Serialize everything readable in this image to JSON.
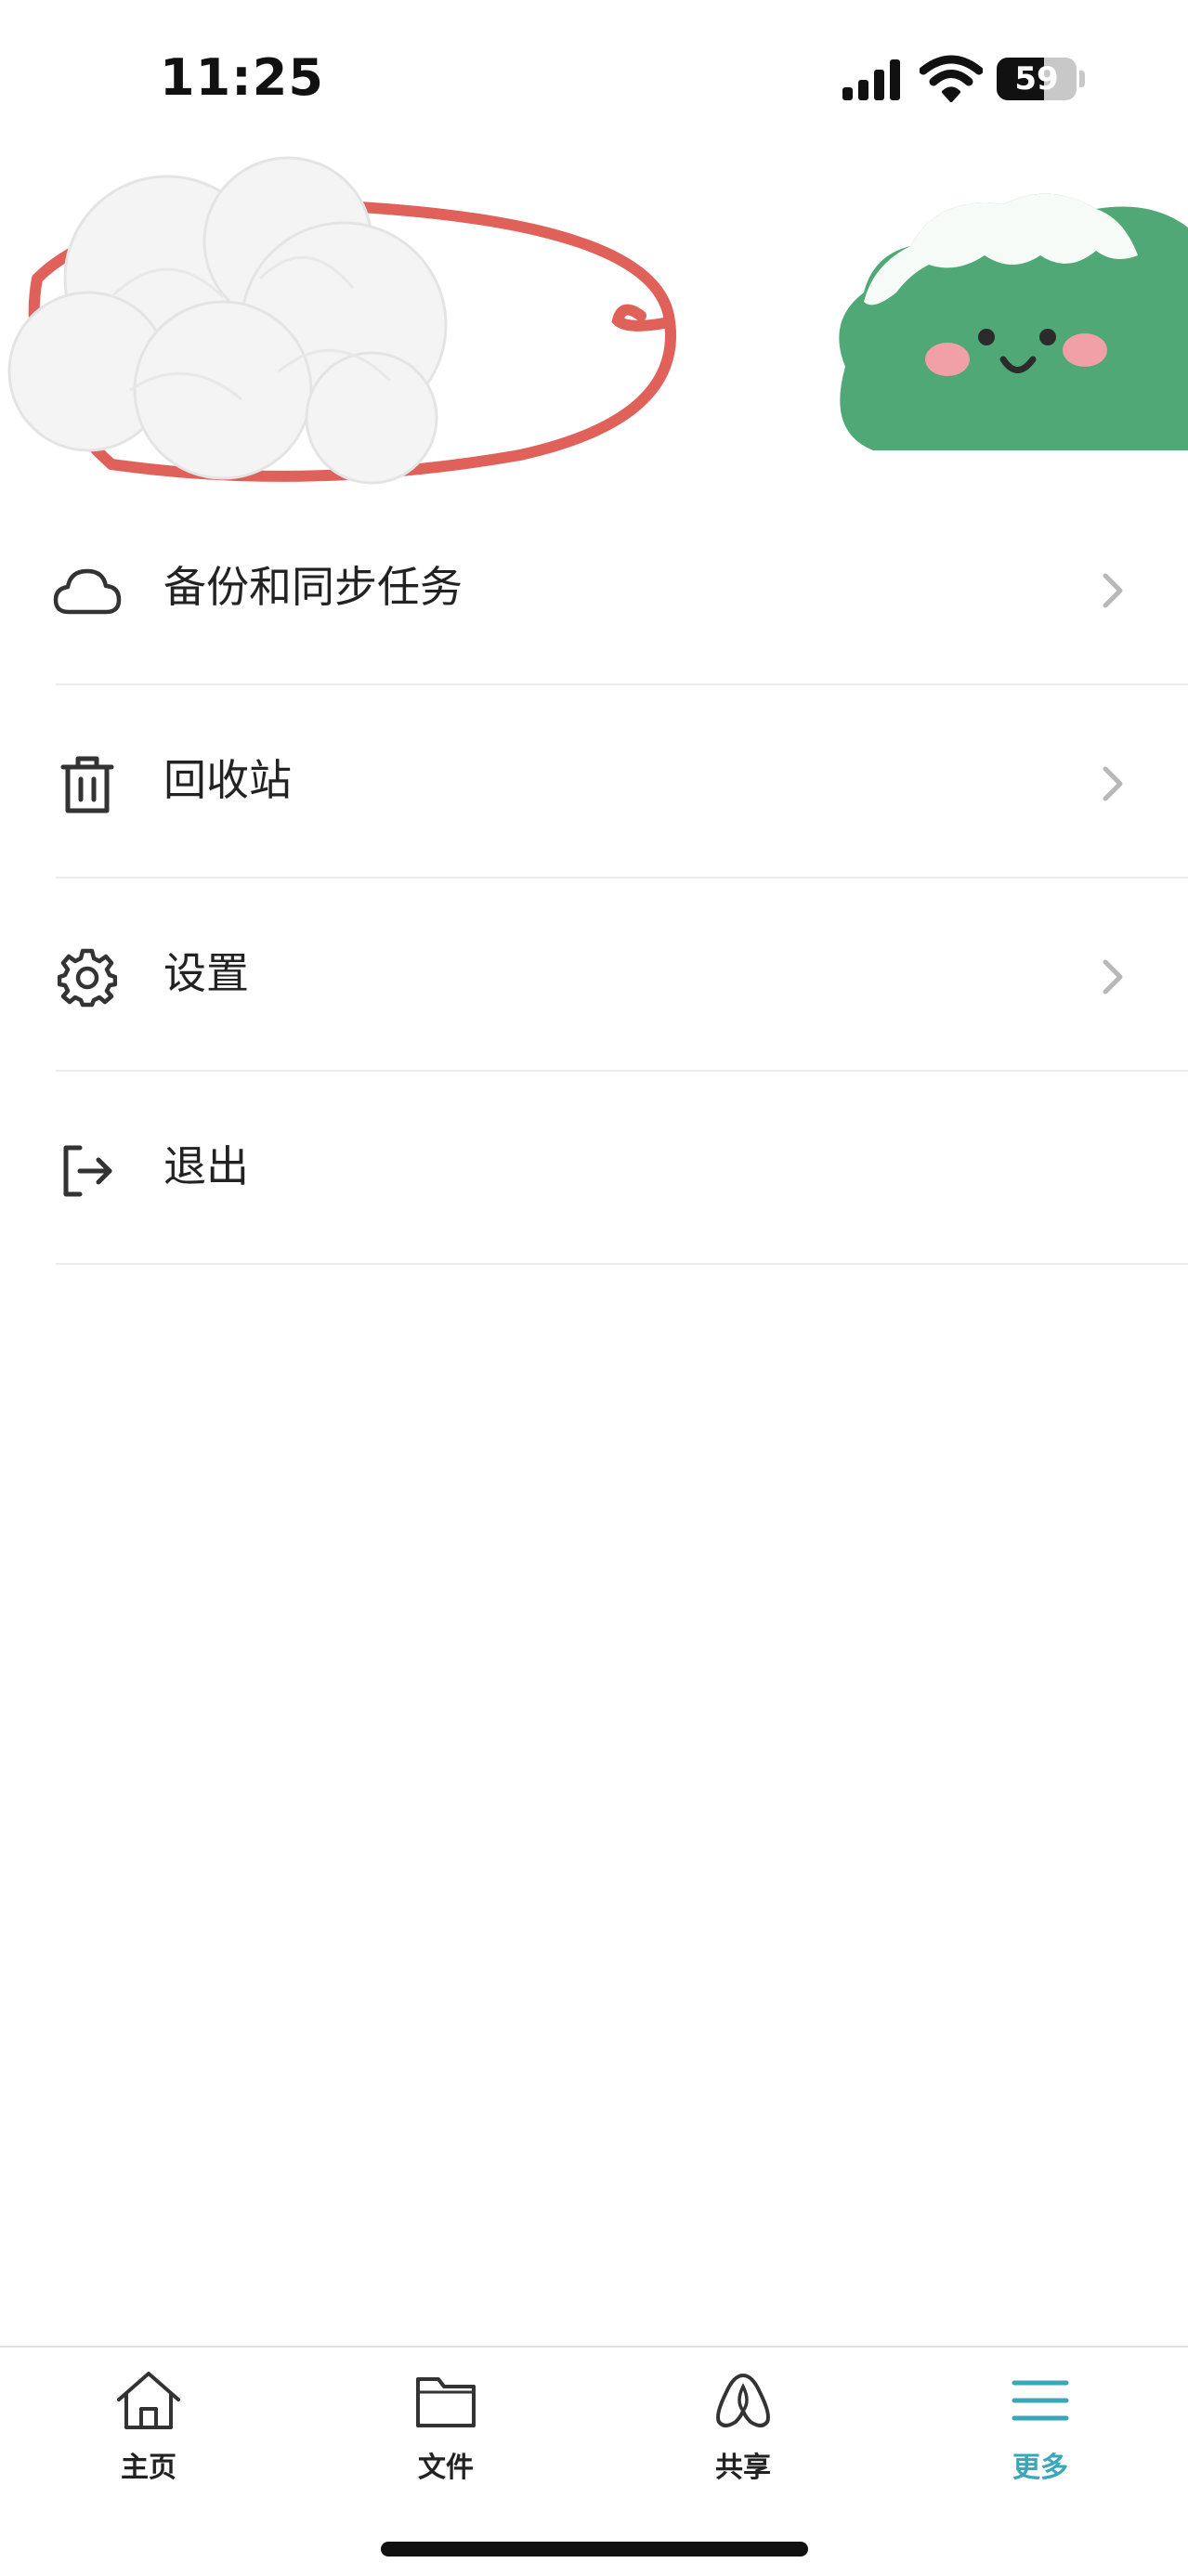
{
  "status_bar": {
    "time": "11:25",
    "battery_level": "59",
    "battery_fraction": 0.59
  },
  "menu": {
    "items": [
      {
        "label": "备份和同步任务",
        "icon": "cloud-icon",
        "has_chevron": true
      },
      {
        "label": "回收站",
        "icon": "trash-icon",
        "has_chevron": true
      },
      {
        "label": "设置",
        "icon": "gear-icon",
        "has_chevron": true
      },
      {
        "label": "退出",
        "icon": "logout-icon",
        "has_chevron": false
      }
    ]
  },
  "tab_bar": {
    "tabs": [
      {
        "label": "主页",
        "icon": "home-icon",
        "active": false
      },
      {
        "label": "文件",
        "icon": "folder-icon",
        "active": false
      },
      {
        "label": "共享",
        "icon": "share-icon",
        "active": false
      },
      {
        "label": "更多",
        "icon": "menu-icon",
        "active": true
      }
    ]
  },
  "colors": {
    "accent": "#3aa6b9",
    "annotation_red": "#e0605a",
    "mascot_green": "#4fa876"
  }
}
